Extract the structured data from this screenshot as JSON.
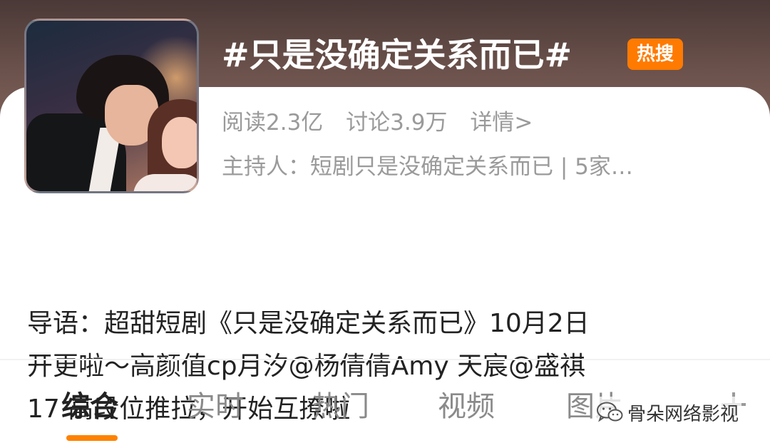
{
  "topic": {
    "title": "#只是没确定关系而已#",
    "badge": "热搜",
    "stats": {
      "reads": "阅读2.3亿",
      "discussions": "讨论3.9万",
      "details": "详情>"
    },
    "host": "主持人：短剧只是没确定关系而已 | 5家…"
  },
  "intro": {
    "line1": "导语：超甜短剧《只是没确定关系而已》10月2日",
    "line2": "开更啦～高颜值cp月汐@杨倩倩Amy 天宸@盛祺",
    "line3": "17 高段位推拉，开始互撩啦"
  },
  "tabs": [
    {
      "label": "综合",
      "active": true
    },
    {
      "label": "实时",
      "active": false
    },
    {
      "label": "热门",
      "active": false
    },
    {
      "label": "视频",
      "active": false
    },
    {
      "label": "图片",
      "active": false
    }
  ],
  "watermark": {
    "icon": "wechat-icon",
    "text": "骨朵网络影视"
  },
  "colors": {
    "accent": "#ff8200",
    "badge": "#ff7a00",
    "header_bg": "#5e4843",
    "muted_text": "#9a9a9a"
  }
}
